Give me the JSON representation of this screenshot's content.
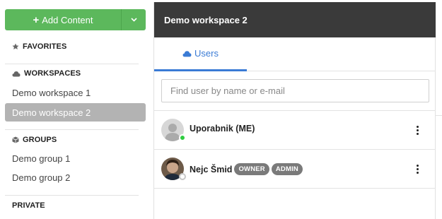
{
  "sidebar": {
    "add_button_label": "Add Content",
    "sections": {
      "favorites": "FAVORITES",
      "workspaces": "WORKSPACES",
      "groups": "GROUPS",
      "private": "PRIVATE"
    },
    "workspaces": [
      "Demo workspace 1",
      "Demo workspace 2"
    ],
    "active_workspace": "Demo workspace 2",
    "groups": [
      "Demo group 1",
      "Demo group 2"
    ],
    "accent_color": "#5cb85c"
  },
  "workspace": {
    "title": "Demo workspace 2",
    "tabs": [
      {
        "label": "Users",
        "icon": "cloud-icon",
        "active": true
      }
    ],
    "search_placeholder": "Find user by name or e-mail",
    "users": [
      {
        "name": "Uporabnik (ME)",
        "status": "online",
        "badges": []
      },
      {
        "name": "Nejc Šmid",
        "status": "offline",
        "badges": [
          "OWNER",
          "ADMIN"
        ]
      }
    ]
  },
  "colors": {
    "header_bg": "#3a3a3a",
    "tab_accent": "#3a7bd5",
    "online": "#2ecc40",
    "badge": "#7a7a7a"
  }
}
